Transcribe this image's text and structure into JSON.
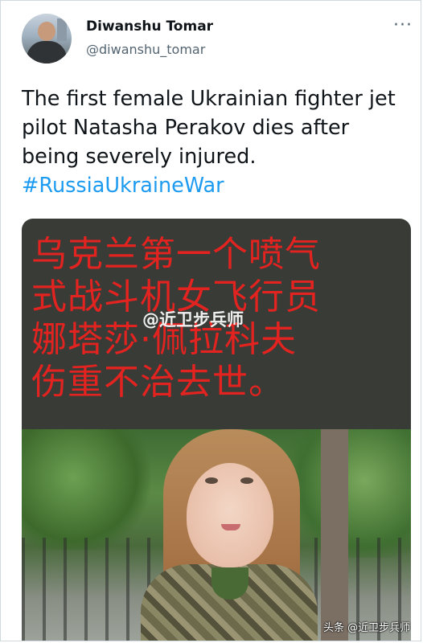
{
  "tweet": {
    "author_name": "Diwanshu Tomar",
    "author_handle": "@diwanshu_tomar",
    "more_label": "···",
    "text": "The first female Ukrainian fighter jet pilot Natasha Perakov dies after being severely injured.",
    "hashtag": "#RussiaUkraineWar"
  },
  "media": {
    "overlay_text": "乌克兰第一个喷气\n式战斗机女飞行员\n娜塔莎·佩拉科夫\n伤重不治去世。",
    "watermark_center": "@近卫步兵师"
  },
  "watermark_corner": "头条 @近卫步兵师",
  "colors": {
    "hashtag": "#1d9bf0",
    "overlay_text": "#e32320",
    "overlay_bg": "#393b37"
  }
}
